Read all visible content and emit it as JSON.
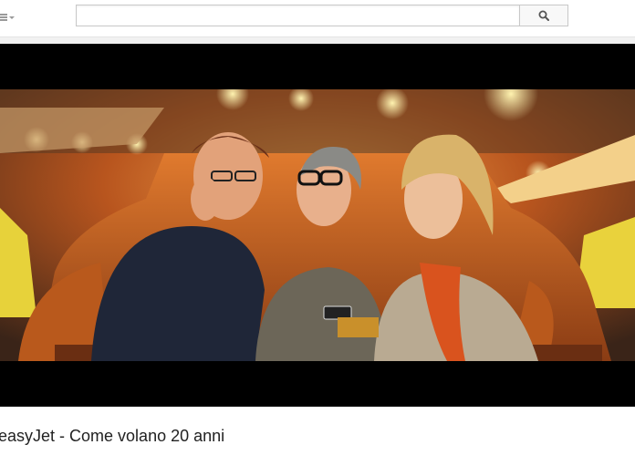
{
  "header": {
    "menu_icon": "hamburger-menu-icon",
    "search": {
      "placeholder": "",
      "value": "",
      "button_icon": "search-icon"
    }
  },
  "player": {
    "scene": "three friends laughing on a fairground ride at night"
  },
  "video": {
    "title": "easyJet - Come volano 20 anni"
  },
  "colors": {
    "page_bg": "#f1f1f1",
    "player_bg": "#000000",
    "title_text": "#222222"
  }
}
